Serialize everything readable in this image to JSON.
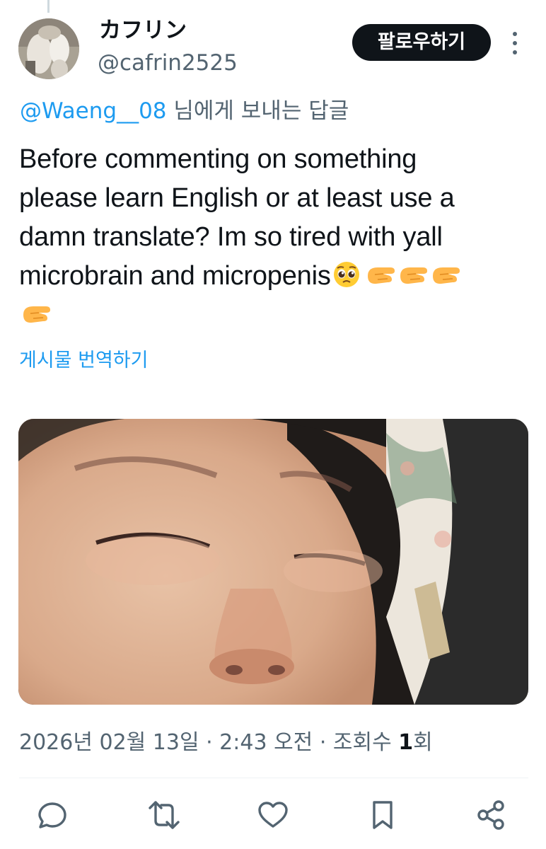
{
  "author": {
    "display_name": "カフリン",
    "handle": "@cafrin2525",
    "avatar_icon": "profile-photo"
  },
  "follow_button": {
    "label": "팔로우하기"
  },
  "more_icon": "more-vertical-icon",
  "reply_context": {
    "mention": "@Waeng__08",
    "suffix": " 님에게 보내는 답글"
  },
  "tweet": {
    "lines": [
      "Before commenting on something",
      "please learn English or at least use a",
      "damn translate? Im so tired with yall",
      "microbrain and micropenis"
    ],
    "emojis": [
      "pleading-face",
      "pinching-hand",
      "pinching-hand",
      "pinching-hand",
      "pinching-hand"
    ]
  },
  "translate_link": "게시물 번역하기",
  "media": {
    "kind": "photo"
  },
  "meta": {
    "timestamp": "2026년 02월 13일 · 2:43 오전 · 조회수 ",
    "view_count": "1",
    "view_suffix": "회"
  },
  "actions": [
    "reply-icon",
    "retweet-icon",
    "like-icon",
    "bookmark-icon",
    "share-icon"
  ],
  "colors": {
    "accent": "#1d9bf0",
    "text": "#0f1419",
    "secondary": "#536471",
    "button_bg": "#0f1419"
  }
}
